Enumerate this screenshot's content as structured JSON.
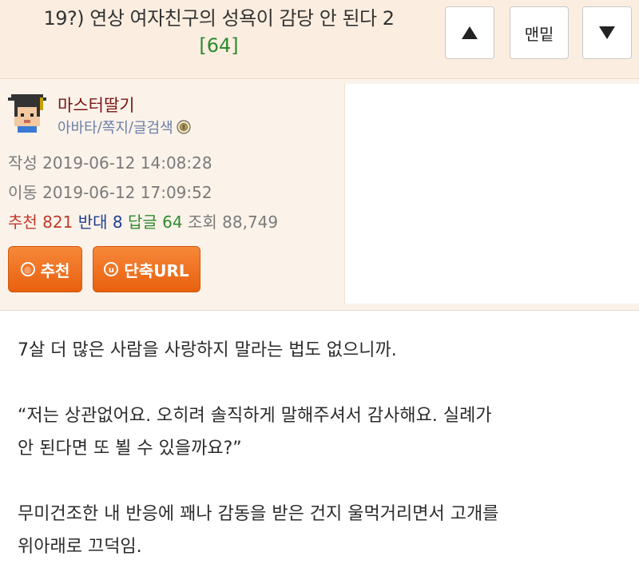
{
  "header": {
    "title": "19?) 연상 여자친구의 성욕이 감당 안 된다 2",
    "reply_count": "[64]",
    "up_icon": "triangle-up-icon",
    "top_label": "맨밑",
    "down_icon": "triangle-down-icon"
  },
  "author": {
    "nickname": "마스터딸기",
    "links": [
      "아바타",
      "쪽지",
      "글검색"
    ],
    "avatar_icon": "pixel-avatar-icon",
    "badge_icon": "member-badge-icon"
  },
  "meta": {
    "write_label": "작성",
    "write_time": "2019-06-12 14:08:28",
    "edit_label": "이동",
    "edit_time": "2019-06-12 17:09:52"
  },
  "stats": {
    "rec_label": "추천",
    "rec_value": "821",
    "opp_label": "반대",
    "opp_value": "8",
    "rep_label": "답글",
    "rep_value": "64",
    "view_label": "조회",
    "view_value": "88,749"
  },
  "actions": {
    "recommend_label": "추천",
    "short_url_label": "단축URL"
  },
  "colors": {
    "header_bg": "#fbeee0",
    "info_bg": "#fbf3ea",
    "accent_orange": "#f07a28",
    "reply_green": "#2f8a2f",
    "nick_red": "#7a1414"
  },
  "content": {
    "paragraphs": [
      "7살 더 많은 사람을 사랑하지 말라는 법도 없으니까.",
      "“저는 상관없어요. 오히려 솔직하게 말해주셔서 감사해요. 실례가\n안 된다면 또 뵐 수 있을까요?”",
      "무미건조한 내 반응에 꽤나 감동을 받은 건지 울먹거리면서 고개를\n위아래로 끄덕임."
    ],
    "p1": "7살 더 많은 사람을 사랑하지 말라는 법도 없으니까.",
    "p2a": "“저는 상관없어요. 오히려 솔직하게 말해주셔서 감사해요. 실례가",
    "p2b": "안 된다면 또 뵐 수 있을까요?”",
    "p3a": "무미건조한 내 반응에 꽤나 감동을 받은 건지 울먹거리면서 고개를",
    "p3b": "위아래로 끄덕임."
  }
}
